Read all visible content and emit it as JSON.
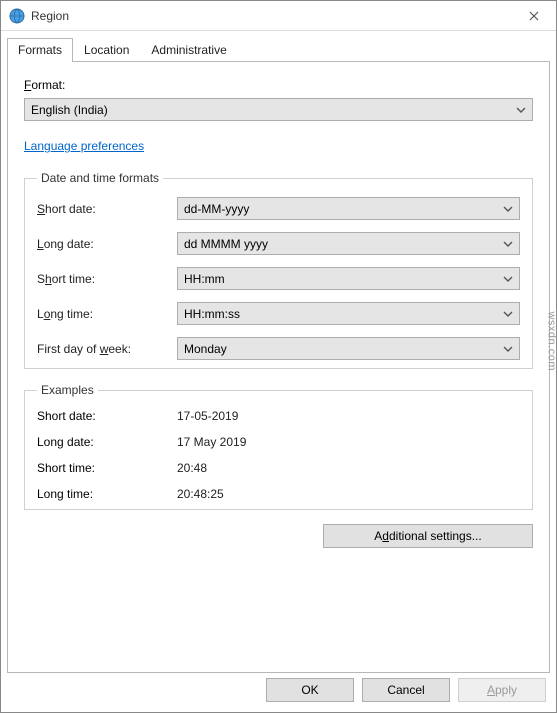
{
  "window": {
    "title": "Region"
  },
  "tabs": [
    {
      "label": "Formats",
      "active": true
    },
    {
      "label": "Location",
      "active": false
    },
    {
      "label": "Administrative",
      "active": false
    }
  ],
  "formatSection": {
    "label_pre": "F",
    "label_post": "ormat:",
    "value": "English (India)"
  },
  "languageLink": "Language preferences",
  "dtFormats": {
    "legend": "Date and time formats",
    "rows": [
      {
        "label_pre": "S",
        "label_mid": "hort date:",
        "value": "dd-MM-yyyy"
      },
      {
        "label_pre": "",
        "label_u": "L",
        "label_post": "ong date:",
        "value": "dd MMMM yyyy"
      },
      {
        "label_pre": "S",
        "label_u": "h",
        "label_post": "ort time:",
        "value": "HH:mm"
      },
      {
        "label_pre": "L",
        "label_u": "o",
        "label_post": "ng time:",
        "value": "HH:mm:ss"
      },
      {
        "label_pre": "First day of ",
        "label_u": "w",
        "label_post": "eek:",
        "value": "Monday"
      }
    ]
  },
  "examples": {
    "legend": "Examples",
    "rows": [
      {
        "label": "Short date:",
        "value": "17-05-2019"
      },
      {
        "label": "Long date:",
        "value": "17 May 2019"
      },
      {
        "label": "Short time:",
        "value": "20:48"
      },
      {
        "label": "Long time:",
        "value": "20:48:25"
      }
    ]
  },
  "additional": {
    "label_pre": "A",
    "label_u": "d",
    "label_post": "ditional settings..."
  },
  "buttons": {
    "ok": "OK",
    "cancel": "Cancel",
    "apply_pre": "A",
    "apply_post": "pply"
  },
  "watermark": "wsxdn.com"
}
